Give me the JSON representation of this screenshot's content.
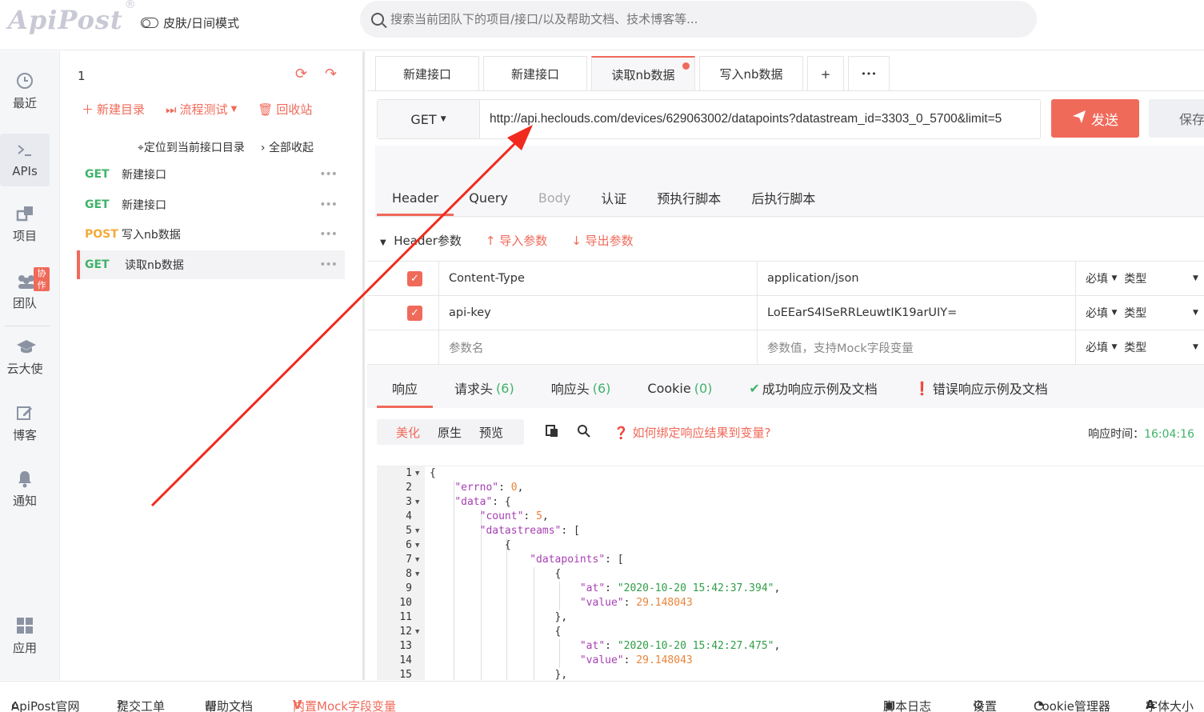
{
  "topbar": {
    "logo": "ApiPost",
    "logo_mark": "®",
    "skin_mode": "皮肤/日间模式",
    "search_placeholder": "搜索当前团队下的项目/接口/以及帮助文档、技术博客等..."
  },
  "rail": {
    "items": [
      {
        "label": "最近",
        "icon": "clock-icon"
      },
      {
        "label": "APIs",
        "icon": "terminal-icon"
      },
      {
        "label": "项目",
        "icon": "projects-icon"
      },
      {
        "label": "团队",
        "icon": "team-icon",
        "badge": "协作"
      },
      {
        "label": "云大使",
        "icon": "graduation-cap-icon"
      },
      {
        "label": "博客",
        "icon": "edit-icon"
      },
      {
        "label": "通知",
        "icon": "bell-icon"
      },
      {
        "label": "应用",
        "icon": "grid-apps-icon"
      }
    ]
  },
  "panel": {
    "project_name": "1",
    "new_folder": "新建目录",
    "flow_test": "流程测试",
    "recycle": "回收站",
    "locate": "定位到当前接口目录",
    "collapse": "全部收起",
    "apis": [
      {
        "method": "GET",
        "name": "新建接口"
      },
      {
        "method": "GET",
        "name": "新建接口"
      },
      {
        "method": "POST",
        "name": "写入nb数据"
      },
      {
        "method": "GET",
        "name": "读取nb数据"
      }
    ],
    "dots": "•••"
  },
  "tabs": [
    {
      "label": "新建接口"
    },
    {
      "label": "新建接口"
    },
    {
      "label": "读取nb数据"
    },
    {
      "label": "写入nb数据"
    },
    {
      "label": "+"
    },
    {
      "label": "•••"
    }
  ],
  "request": {
    "method": "GET",
    "url": "http://api.heclouds.com/devices/629063002/datapoints?datastream_id=3303_0_5700&limit=5",
    "send": "发送",
    "save": "保存"
  },
  "subtabs": [
    "Header",
    "Query",
    "Body",
    "认证",
    "预执行脚本",
    "后执行脚本"
  ],
  "header_tools": {
    "params": "Header参数",
    "import": "导入参数",
    "export": "导出参数"
  },
  "params": [
    {
      "key": "Content-Type",
      "value": "application/json",
      "required": "必填",
      "type": "类型"
    },
    {
      "key": "api-key",
      "value": "LoEEarS4ISeRRLeuwtIK19arUIY=",
      "required": "必填",
      "type": "类型"
    },
    {
      "key": "参数名",
      "value": "参数值，支持Mock字段变量",
      "required": "必填",
      "type": "类型"
    }
  ],
  "response_tabs": {
    "resp": "响应",
    "req_headers": "请求头",
    "req_headers_n": "(6)",
    "resp_headers": "响应头",
    "resp_headers_n": "(6)",
    "cookie": "Cookie",
    "cookie_n": "(0)",
    "success": "成功响应示例及文档",
    "error": "错误响应示例及文档"
  },
  "format": {
    "pretty": "美化",
    "raw": "原生",
    "preview": "预览",
    "bind_tip": "如何绑定响应结果到变量?",
    "time_label": "响应时间：",
    "time_value": "16:04:16"
  },
  "code_lines": [
    "1",
    "2",
    "3",
    "4",
    "5",
    "6",
    "7",
    "8",
    "9",
    "10",
    "11",
    "12",
    "13",
    "14",
    "15"
  ],
  "bottom": {
    "site": "ApiPost官网",
    "ticket": "提交工单",
    "docs": "帮助文档",
    "mock": "内置Mock字段变量",
    "log": "脚本日志",
    "settings": "设置",
    "cookie_mgr": "Cookie管理器",
    "font": "字体大小"
  },
  "colors": {
    "accent": "#f06a5a",
    "get": "#3fb36a",
    "post": "#f3a93b"
  }
}
